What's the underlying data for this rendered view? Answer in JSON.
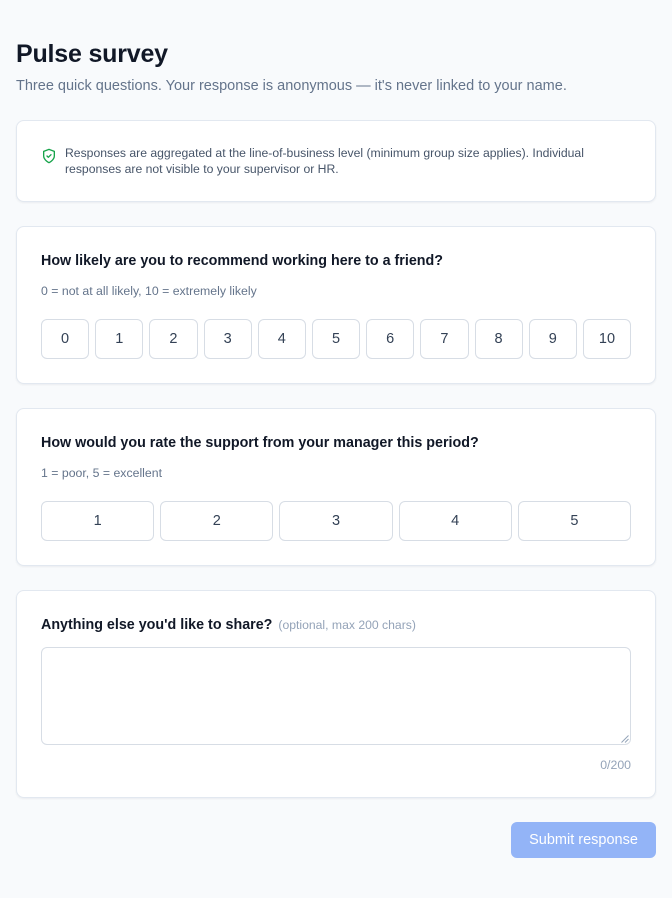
{
  "header": {
    "title": "Pulse survey",
    "subtitle": "Three quick questions. Your response is anonymous — it's never linked to your name."
  },
  "notice": {
    "icon": "shield-check-icon",
    "text": "Responses are aggregated at the line-of-business level (minimum group size applies). Individual responses are not visible to your supervisor or HR."
  },
  "questions": {
    "q1": {
      "title": "How likely are you to recommend working here to a friend?",
      "hint": "0 = not at all likely, 10 = extremely likely",
      "options": [
        "0",
        "1",
        "2",
        "3",
        "4",
        "5",
        "6",
        "7",
        "8",
        "9",
        "10"
      ]
    },
    "q2": {
      "title": "How would you rate the support from your manager this period?",
      "hint": "1 = poor, 5 = excellent",
      "options": [
        "1",
        "2",
        "3",
        "4",
        "5"
      ]
    },
    "q3": {
      "title": "Anything else you'd like to share?",
      "optional_note": "(optional, max 200 chars)",
      "value": "",
      "char_count": "0/200"
    }
  },
  "actions": {
    "submit_label": "Submit response"
  },
  "colors": {
    "accent_disabled": "#93b4f7",
    "shield_green": "#16a34a"
  }
}
